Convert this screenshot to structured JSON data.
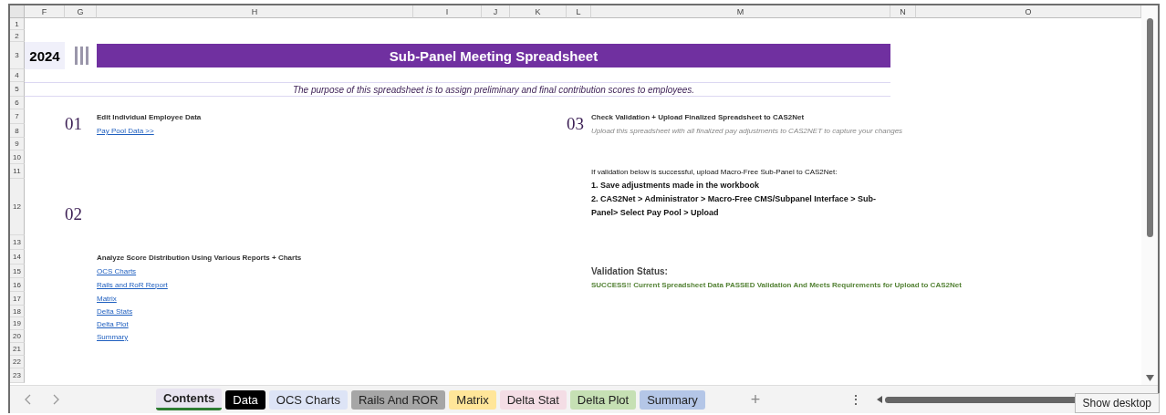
{
  "sheet": {
    "columns": [
      "F",
      "G",
      "H",
      "I",
      "J",
      "K",
      "L",
      "M",
      "N",
      "O"
    ],
    "rows": [
      "1",
      "2",
      "3",
      "4",
      "5",
      "6",
      "7",
      "8",
      "9",
      "10",
      "11",
      "12",
      "13",
      "14",
      "15",
      "16",
      "17",
      "18",
      "19",
      "20",
      "21",
      "22",
      "23"
    ]
  },
  "banner": {
    "year": "2024",
    "title": "Sub-Panel Meeting Spreadsheet"
  },
  "purpose": "The purpose of this spreadsheet is to assign preliminary and final contribution scores to employees.",
  "section_1": {
    "number": "01",
    "heading": "Edit Individual Employee Data",
    "link": "Pay Pool Data >>"
  },
  "section_2": {
    "number": "02",
    "heading": "Analyze Score Distribution Using Various Reports + Charts",
    "links": [
      "OCS Charts",
      "Rails and RoR Report",
      "Matrix",
      "Delta Stats",
      "Delta Plot",
      "Summary "
    ]
  },
  "section_3": {
    "number": "03",
    "heading": "Check Validation + Upload Finalized Spreadsheet to CAS2Net",
    "note": "Upload this spreadsheet with all finalized pay adjustments to CAS2NET to capture your changes",
    "intro": "If validation below is successful, upload Macro-Free Sub-Panel to CAS2Net:",
    "steps": [
      "1. Save adjustments made in the workbook",
      "2. CAS2Net > Administrator > Macro-Free CMS/Subpanel Interface > Sub-Panel> Select Pay Pool > Upload"
    ],
    "status_label": "Validation Status:",
    "status": "SUCCESS!! Current Spreadsheet Data PASSED Validation And Meets Requirements for Upload to CAS2Net"
  },
  "tabs": [
    {
      "label": "Contents",
      "selected": true,
      "color": "#e8e4f0"
    },
    {
      "label": "Data",
      "selected": false,
      "color": "#000000"
    },
    {
      "label": "OCS Charts",
      "selected": false,
      "color": "#dde4f6"
    },
    {
      "label": "Rails And ROR",
      "selected": false,
      "color": "#a6a6a6"
    },
    {
      "label": "Matrix",
      "selected": false,
      "color": "#ffe699"
    },
    {
      "label": "Delta Stat",
      "selected": false,
      "color": "#f4dde5"
    },
    {
      "label": "Delta Plot",
      "selected": false,
      "color": "#c6e0b4"
    },
    {
      "label": "Summary",
      "selected": false,
      "color": "#b4c6e7"
    }
  ],
  "new_sheet": "+",
  "more": "⋮",
  "tooltip": "Show desktop"
}
